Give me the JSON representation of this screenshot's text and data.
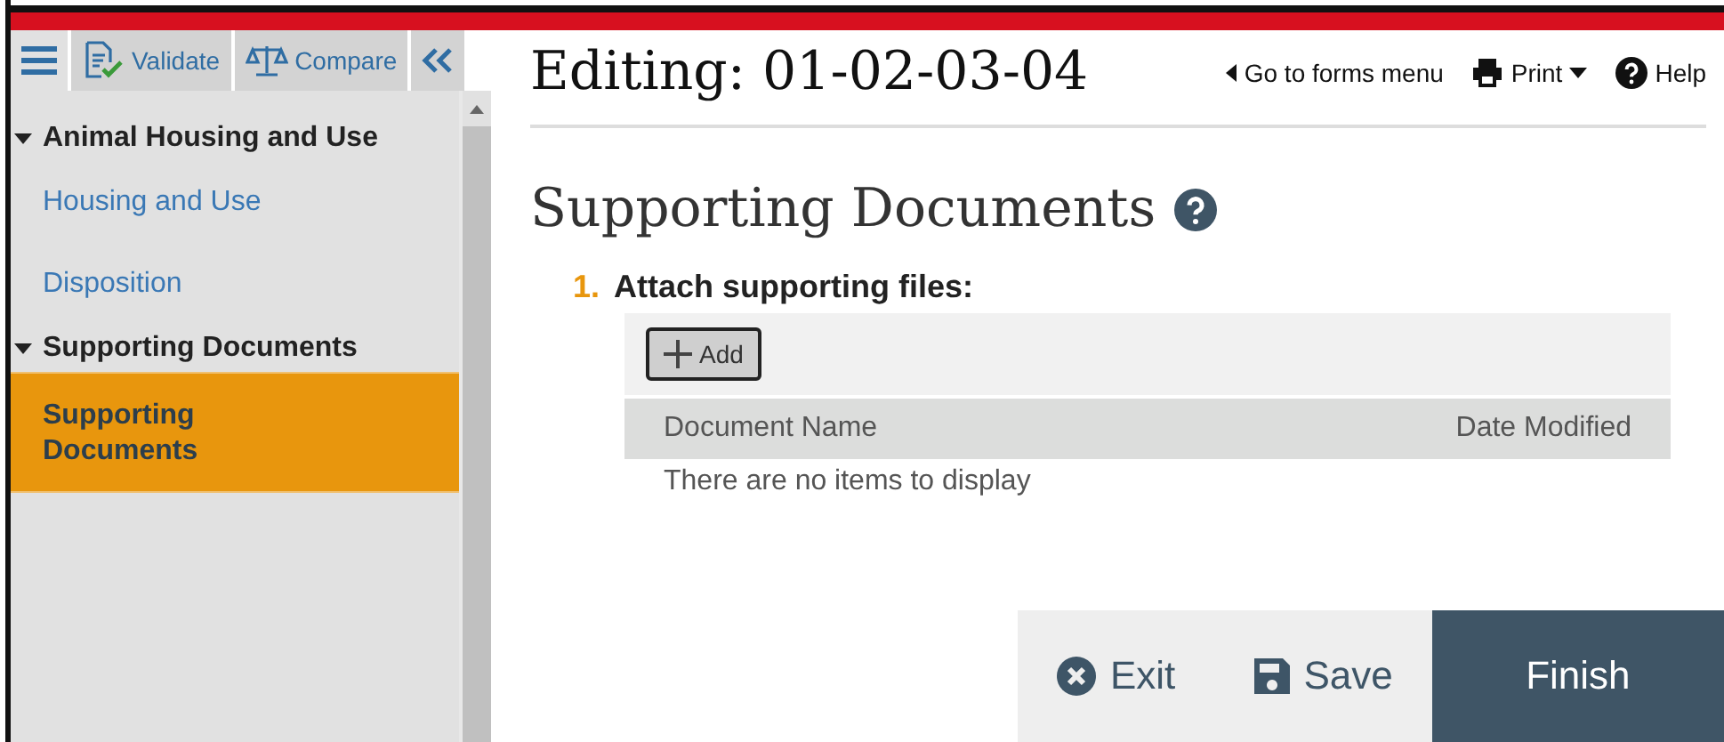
{
  "toolbar": {
    "items": [
      {
        "kind": "menu"
      },
      {
        "kind": "validate",
        "label": "Validate"
      },
      {
        "kind": "compare",
        "label": "Compare"
      },
      {
        "kind": "collapse"
      }
    ]
  },
  "sidebar": {
    "sections": [
      {
        "title": "Animal Housing and Use",
        "expanded": true,
        "children": [
          {
            "label": "Housing and Use",
            "selected": false
          },
          {
            "label": "Disposition",
            "selected": false
          }
        ]
      },
      {
        "title": "Supporting Documents",
        "expanded": true,
        "children": [
          {
            "label": "Supporting Documents",
            "selected": true
          }
        ]
      }
    ]
  },
  "header": {
    "title": "Editing: 01-02-03-04",
    "links": [
      {
        "kind": "back",
        "label": "Go to forms menu"
      },
      {
        "kind": "print",
        "label": "Print"
      },
      {
        "kind": "help",
        "label": "Help"
      }
    ]
  },
  "page": {
    "title": "Supporting Documents",
    "question": {
      "number": "1.",
      "text": "Attach supporting files:",
      "add_button": "Add",
      "table": {
        "columns": [
          "Document Name",
          "Date Modified"
        ],
        "empty_message": "There are no items to display"
      }
    }
  },
  "footer": {
    "buttons": [
      {
        "kind": "exit",
        "label": "Exit"
      },
      {
        "kind": "save",
        "label": "Save"
      },
      {
        "kind": "finish",
        "label": "Finish"
      }
    ]
  }
}
